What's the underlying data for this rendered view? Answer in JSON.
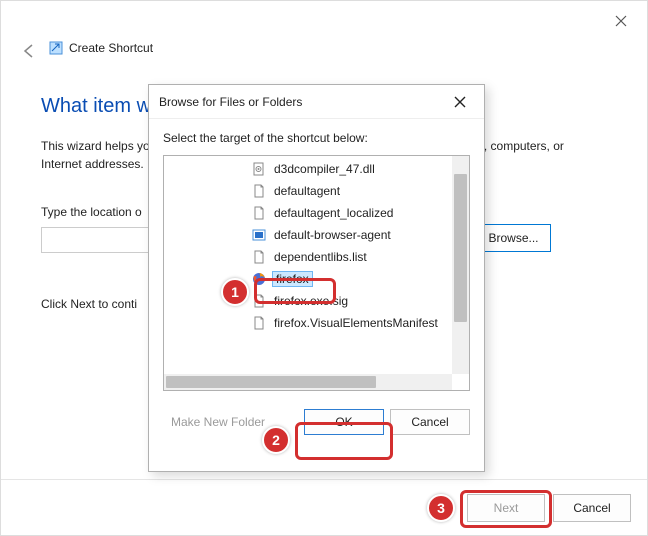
{
  "wizard": {
    "title": "Create Shortcut",
    "heading_visible": "What item wo",
    "description": "This wizard helps you to create shortcuts to local or network programs, files, folders, computers, or Internet addresses.",
    "location_label_visible": "Type the location o",
    "browse_label": "Browse...",
    "hint_visible": "Click Next to conti",
    "next_label": "Next",
    "cancel_label": "Cancel"
  },
  "dialog": {
    "title": "Browse for Files or Folders",
    "instruction": "Select the target of the shortcut below:",
    "make_folder_label": "Make New Folder",
    "ok_label": "OK",
    "cancel_label": "Cancel",
    "files": [
      {
        "name": "d3dcompiler_47.dll",
        "icon": "dll",
        "selected": false
      },
      {
        "name": "defaultagent",
        "icon": "file",
        "selected": false
      },
      {
        "name": "defaultagent_localized",
        "icon": "file",
        "selected": false
      },
      {
        "name": "default-browser-agent",
        "icon": "exe",
        "selected": false
      },
      {
        "name": "dependentlibs.list",
        "icon": "file",
        "selected": false
      },
      {
        "name": "firefox",
        "icon": "firefox",
        "selected": true
      },
      {
        "name": "firefox.exe.sig",
        "icon": "file",
        "selected": false
      },
      {
        "name": "firefox.VisualElementsManifest",
        "icon": "file",
        "selected": false
      }
    ]
  },
  "annotations": {
    "1": "1",
    "2": "2",
    "3": "3"
  }
}
